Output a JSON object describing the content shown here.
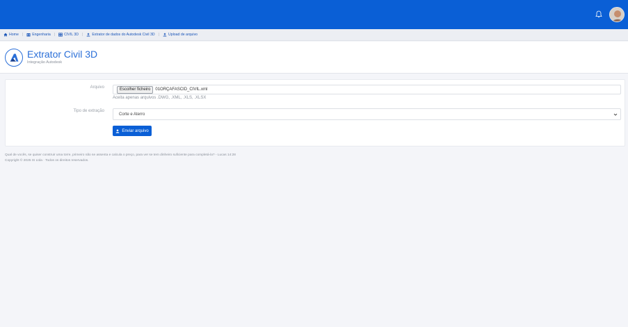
{
  "breadcrumb": [
    {
      "label": "Home",
      "icon": "home-icon"
    },
    {
      "label": "Engenharia",
      "icon": "building-icon"
    },
    {
      "label": "CIVIL 3D",
      "icon": "grid-icon"
    },
    {
      "label": "Extrator de dados do Autodesk Civil 3D",
      "icon": "upload-icon"
    },
    {
      "label": "Upload de arquivo",
      "icon": "upload-icon"
    }
  ],
  "header": {
    "title": "Extrator Civil 3D",
    "subtitle": "Integração Autodesk"
  },
  "form": {
    "file_label": "Arquivo",
    "file_button": "Escolher ficheiro",
    "file_name": "01ORÇAFASCID_CIVIL.xml",
    "file_hint": "Aceita apenas arquivos .DWG, .XML, .XLS, .XLSX",
    "extraction_label": "Tipo de extração",
    "extraction_value": "Corte e Aterro",
    "submit_label": "Enviar arquivo"
  },
  "footer": {
    "quote": "Qual de vocês, se quiser construir uma torre, primeiro não se assenta e calcula o preço, para ver se tem dinheiro suficiente para completá-la? - Lucas 14:28",
    "copyright": "Copyright © 2025 IS Ltda · Todos os direitos reservados."
  },
  "colors": {
    "primary": "#0a5fd6",
    "background": "#f4f5f9",
    "link": "#1a55b8"
  }
}
